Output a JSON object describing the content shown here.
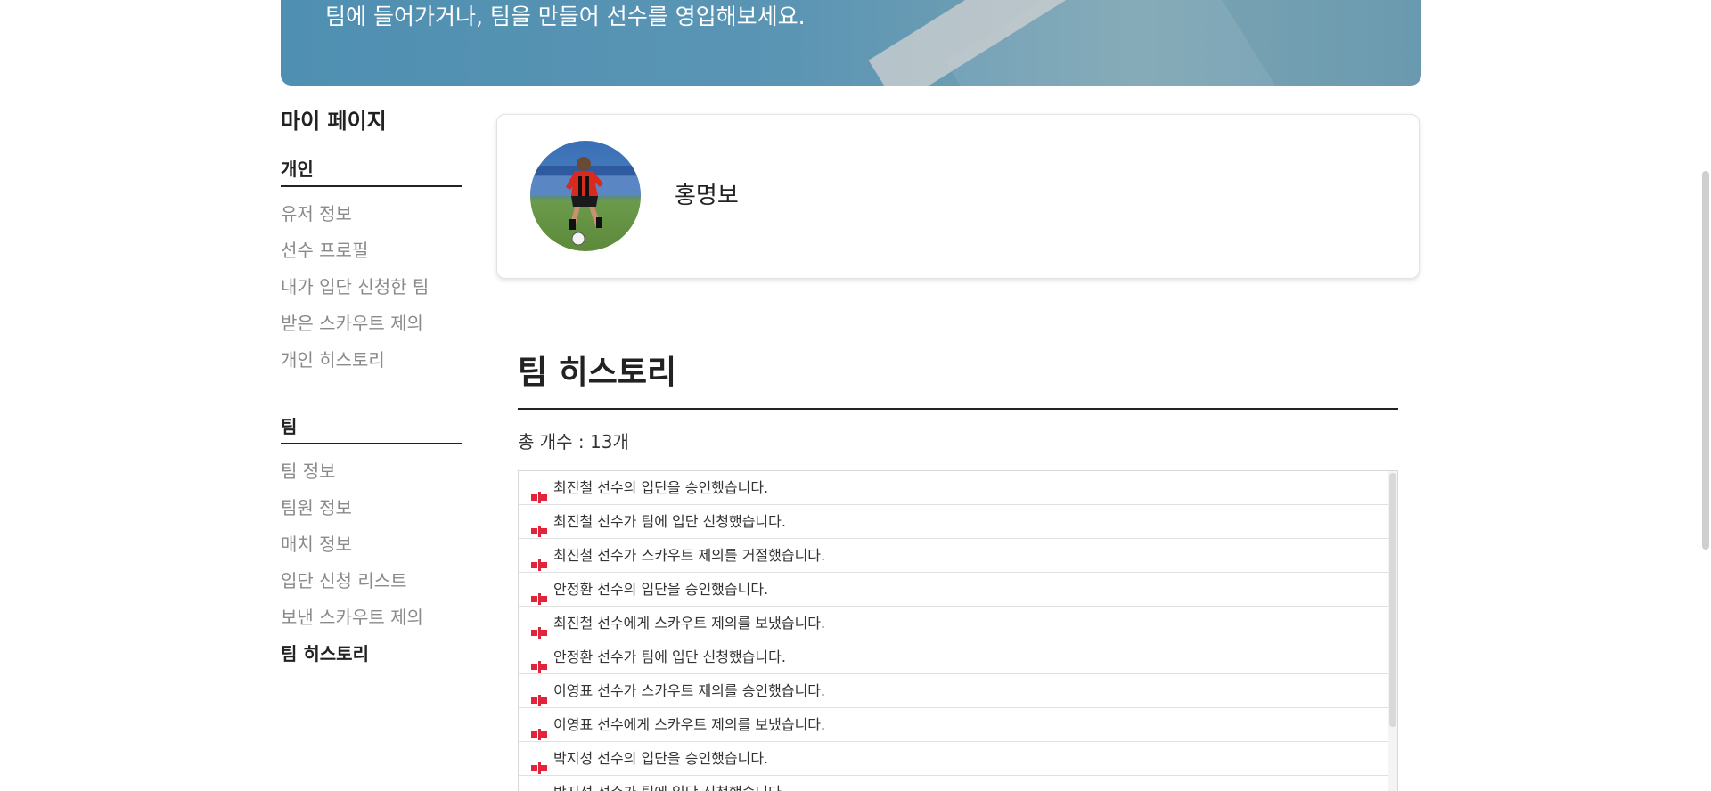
{
  "hero": {
    "text": "팀에 들어가거나, 팀을 만들어 선수를 영입해보세요."
  },
  "sidebar": {
    "title": "마이 페이지",
    "personal": {
      "heading": "개인",
      "items": [
        {
          "label": "유저 정보"
        },
        {
          "label": "선수 프로필"
        },
        {
          "label": "내가 입단 신청한 팀"
        },
        {
          "label": "받은 스카우트 제의"
        },
        {
          "label": "개인 히스토리"
        }
      ]
    },
    "team": {
      "heading": "팀",
      "items": [
        {
          "label": "팀 정보"
        },
        {
          "label": "팀원 정보"
        },
        {
          "label": "매치 정보"
        },
        {
          "label": "입단 신청 리스트"
        },
        {
          "label": "보낸 스카우트 제의"
        },
        {
          "label": "팀 히스토리",
          "active": true
        }
      ]
    }
  },
  "profile": {
    "name": "홍명보",
    "avatar_icon": "player-photo"
  },
  "history": {
    "title": "팀 히스토리",
    "count_text": "총 개수 : 13개",
    "rows": [
      {
        "text": "최진철 선수의 입단을 승인했습니다."
      },
      {
        "text": "최진철 선수가 팀에 입단 신청했습니다."
      },
      {
        "text": "최진철 선수가 스카우트 제의를 거절했습니다."
      },
      {
        "text": "안정환 선수의 입단을 승인했습니다."
      },
      {
        "text": "최진철 선수에게 스카우트 제의를 보냈습니다."
      },
      {
        "text": "안정환 선수가 팀에 입단 신청했습니다."
      },
      {
        "text": "이영표 선수가 스카우트 제의를 승인했습니다."
      },
      {
        "text": "이영표 선수에게 스카우트 제의를 보냈습니다."
      },
      {
        "text": "박지성 선수의 입단을 승인했습니다."
      },
      {
        "text": "박지성 선수가 팀에 입단 신청했습니다."
      }
    ],
    "row_icon": "flag-icon"
  },
  "colors": {
    "hero_bg": "#4f8fb1",
    "accent_text": "#222222",
    "muted_text": "#8a8a8a",
    "flag_red": "#e0243c"
  }
}
